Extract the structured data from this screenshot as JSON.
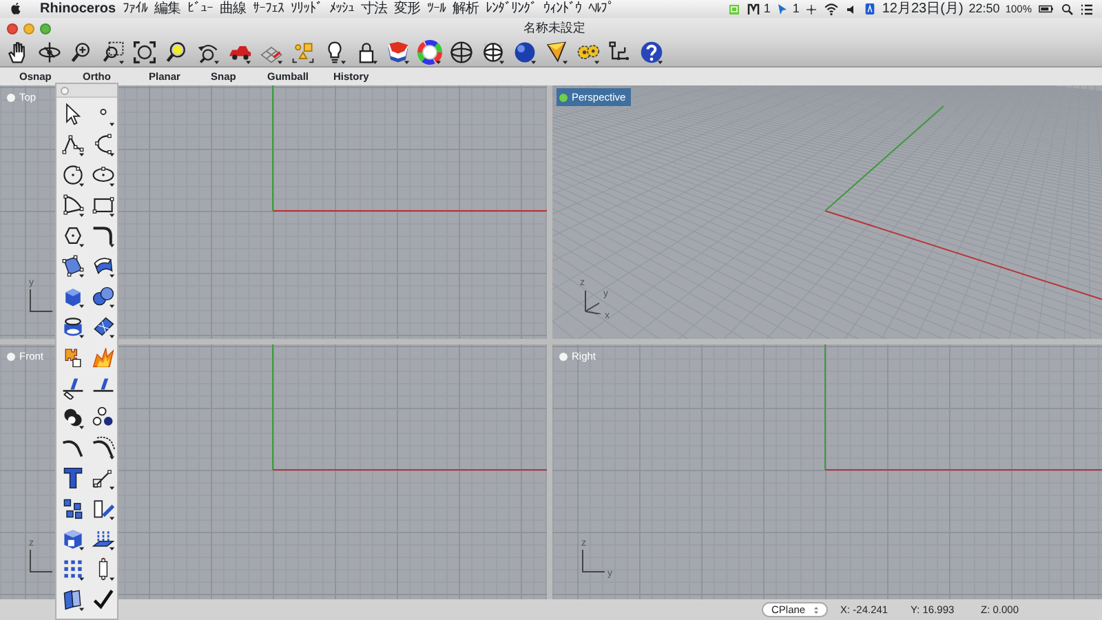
{
  "menu_bar": {
    "app_name": "Rhinoceros",
    "menus": [
      "ﾌｧｲﾙ",
      "編集",
      "ﾋﾞｭｰ",
      "曲線",
      "ｻｰﾌｪｽ",
      "ｿﾘｯﾄﾞ",
      "ﾒｯｼｭ",
      "寸法",
      "変形",
      "ﾂｰﾙ",
      "解析",
      "ﾚﾝﾀﾞﾘﾝｸﾞ",
      "ｳｨﾝﾄﾞｳ",
      "ﾍﾙﾌﾟ"
    ],
    "extras": [
      {
        "kind": "letter",
        "text": "1"
      },
      {
        "kind": "cursor",
        "text": "1"
      }
    ],
    "date": "12月23日(月)",
    "time": "22:50",
    "battery": "100%"
  },
  "window": {
    "title": "名称未設定"
  },
  "status_toggles": [
    "Osnap",
    "Ortho",
    "Planar",
    "Snap",
    "Gumball",
    "History"
  ],
  "viewports": [
    {
      "title": "Top",
      "kind": "plan",
      "selected": false,
      "axes": [
        "y"
      ]
    },
    {
      "title": "Perspective",
      "kind": "perspective",
      "selected": true,
      "axes": [
        "z",
        "y",
        "x"
      ]
    },
    {
      "title": "Front",
      "kind": "plan",
      "selected": false,
      "axes": [
        "z"
      ]
    },
    {
      "title": "Right",
      "kind": "plan",
      "selected": false,
      "axes": [
        "z",
        "y"
      ]
    }
  ],
  "status_bar": {
    "cplane": "CPlane",
    "x": "X: -24.241",
    "y": "Y: 16.993",
    "z": "Z: 0.000"
  }
}
